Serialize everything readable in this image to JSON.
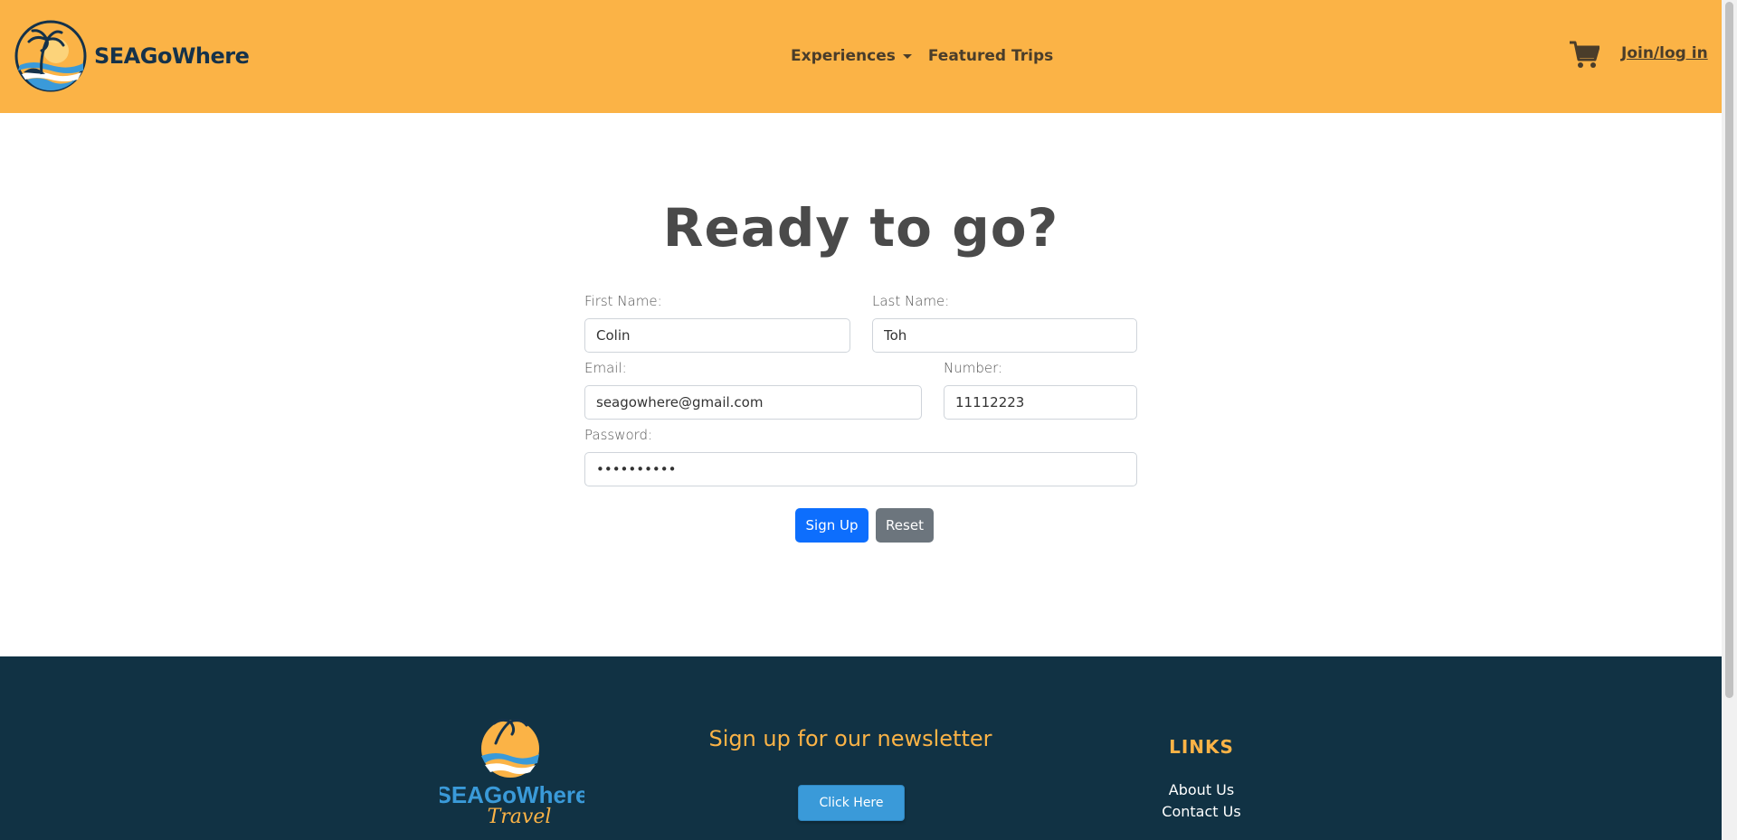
{
  "navbar": {
    "brand_name": "SEAGoWhere",
    "links": [
      {
        "label": "Experiences",
        "has_dropdown": true
      },
      {
        "label": "Featured Trips",
        "has_dropdown": false
      }
    ],
    "cart_icon": "cart-icon",
    "login_label": "Join/log in"
  },
  "signup": {
    "heading": "Ready to go?",
    "first_name": {
      "label": "First Name:",
      "value": "Colin"
    },
    "last_name": {
      "label": "Last Name:",
      "value": "Toh"
    },
    "email": {
      "label": "Email:",
      "value": "seagowhere@gmail.com"
    },
    "number": {
      "label": "Number:",
      "value": "11112223"
    },
    "password": {
      "label": "Password:",
      "value": "••••••••••"
    },
    "submit_label": "Sign Up",
    "reset_label": "Reset"
  },
  "footer": {
    "logo_text": "SEAGoWhere",
    "logo_subtext": "Travel",
    "newsletter_title": "Sign up for our newsletter",
    "newsletter_button": "Click Here",
    "links_title": "LINKS",
    "links": [
      "About Us",
      "Contact Us"
    ]
  },
  "colors": {
    "navbar_bg": "#fbb346",
    "footer_bg": "#113244",
    "primary_button": "#0d6efd",
    "secondary_button": "#6c757d",
    "accent_orange": "#fbb346"
  }
}
